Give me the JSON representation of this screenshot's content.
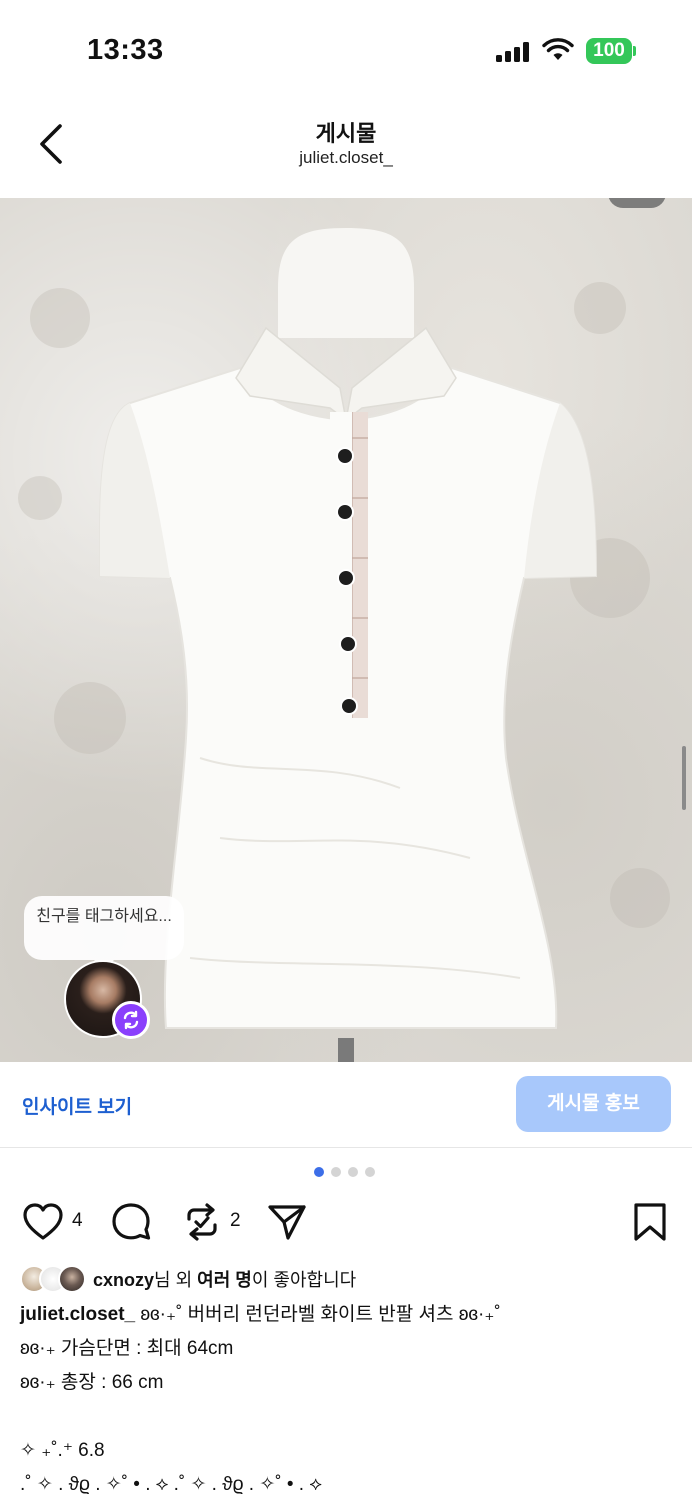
{
  "status_bar": {
    "time": "13:33",
    "battery": "100"
  },
  "header": {
    "title": "게시물",
    "subtitle": "juliet.closet_"
  },
  "photo": {
    "tag_prompt": "친구를 태그하세요...",
    "colors": {
      "badge": "#8a3ffc"
    }
  },
  "insights": {
    "link_label": "인사이트 보기",
    "promote_label": "게시물 홍보"
  },
  "carousel": {
    "pages": 4,
    "current": 1
  },
  "actions": {
    "like_count": "4",
    "repost_count": "2"
  },
  "likes": {
    "username": "cxnozy",
    "suffix_1": "님 외 ",
    "bold": "여러 명",
    "suffix_2": "이 좋아합니다"
  },
  "caption": {
    "username": "juliet.closet_",
    "line1": " ʚɞ·₊˚ 버버리 런던라벨 화이트 반팔 셔츠 ʚɞ·₊˚",
    "line2": "ʚɞ·₊ 가슴단면 : 최대 64cm",
    "line3": "ʚɞ·₊ 총장 : 66 cm",
    "line4": "✧ ₊˚.⁺ 6.8",
    "line5": ".˚ ✧ . ϑϱ . ✧˚ • . ⟡ .˚ ✧ . ϑϱ . ✧˚ • . ⟡"
  },
  "theme": {
    "accent": "#1d5fd0",
    "promote_bg": "#a8c8fb",
    "battery": "#34c759"
  }
}
